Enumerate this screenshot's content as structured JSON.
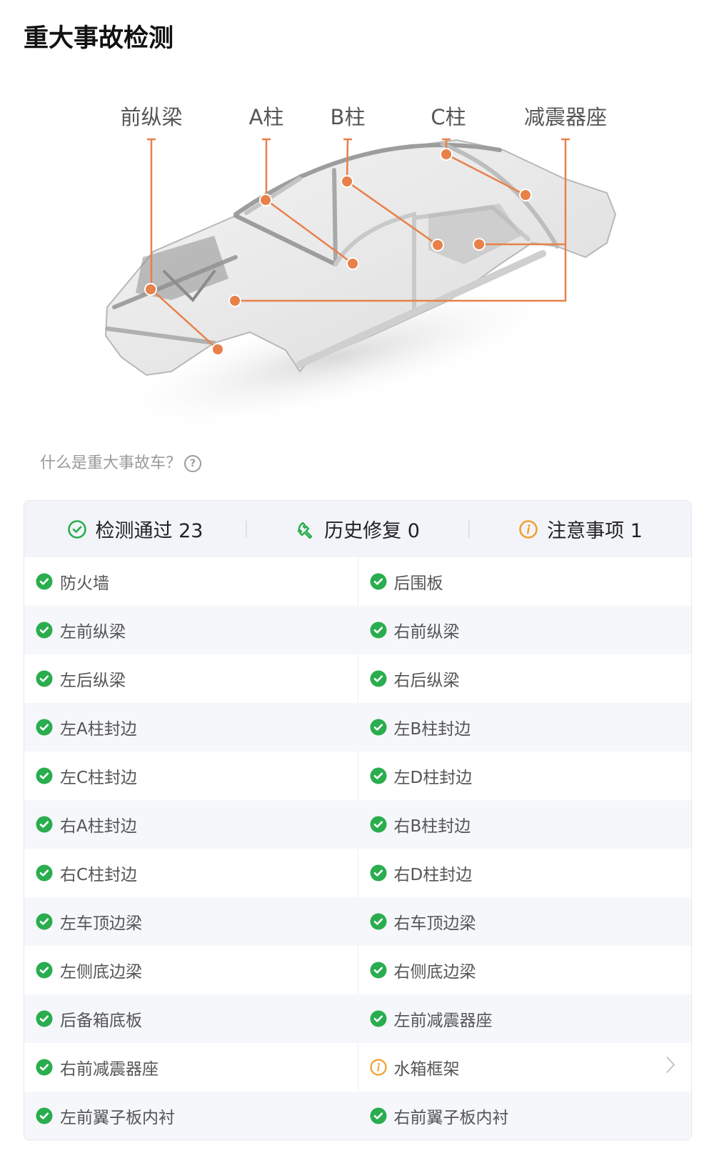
{
  "page": {
    "title": "重大事故检测",
    "help_text": "什么是重大事故车？",
    "help_icon": "question-circle-icon"
  },
  "diagram": {
    "accent_color": "#e8804a",
    "labels": [
      {
        "id": "front-rail",
        "text": "前纵梁"
      },
      {
        "id": "a-pillar",
        "text": "A柱"
      },
      {
        "id": "b-pillar",
        "text": "B柱"
      },
      {
        "id": "c-pillar",
        "text": "C柱"
      },
      {
        "id": "shock-tower",
        "text": "减震器座"
      }
    ]
  },
  "summary": {
    "passed": {
      "label": "检测通过",
      "count": "23",
      "icon": "check-circle-outline-icon",
      "color": "#2aad4e"
    },
    "repaired": {
      "label": "历史修复",
      "count": "0",
      "icon": "wrench-icon",
      "color": "#2aad4e"
    },
    "attention": {
      "label": "注意事项",
      "count": "1",
      "icon": "info-circle-icon",
      "color": "#f0a030"
    }
  },
  "colors": {
    "pass": "#2aad4e",
    "warn": "#f0a030"
  },
  "items": [
    [
      {
        "label": "防火墙",
        "status": "pass"
      },
      {
        "label": "后围板",
        "status": "pass"
      }
    ],
    [
      {
        "label": "左前纵梁",
        "status": "pass"
      },
      {
        "label": "右前纵梁",
        "status": "pass"
      }
    ],
    [
      {
        "label": "左后纵梁",
        "status": "pass"
      },
      {
        "label": "右后纵梁",
        "status": "pass"
      }
    ],
    [
      {
        "label": "左A柱封边",
        "status": "pass"
      },
      {
        "label": "左B柱封边",
        "status": "pass"
      }
    ],
    [
      {
        "label": "左C柱封边",
        "status": "pass"
      },
      {
        "label": "左D柱封边",
        "status": "pass"
      }
    ],
    [
      {
        "label": "右A柱封边",
        "status": "pass"
      },
      {
        "label": "右B柱封边",
        "status": "pass"
      }
    ],
    [
      {
        "label": "右C柱封边",
        "status": "pass"
      },
      {
        "label": "右D柱封边",
        "status": "pass"
      }
    ],
    [
      {
        "label": "左车顶边梁",
        "status": "pass"
      },
      {
        "label": "右车顶边梁",
        "status": "pass"
      }
    ],
    [
      {
        "label": "左侧底边梁",
        "status": "pass"
      },
      {
        "label": "右侧底边梁",
        "status": "pass"
      }
    ],
    [
      {
        "label": "后备箱底板",
        "status": "pass"
      },
      {
        "label": "左前减震器座",
        "status": "pass"
      }
    ],
    [
      {
        "label": "右前减震器座",
        "status": "pass"
      },
      {
        "label": "水箱框架",
        "status": "warn",
        "has_detail": true
      }
    ],
    [
      {
        "label": "左前翼子板内衬",
        "status": "pass"
      },
      {
        "label": "右前翼子板内衬",
        "status": "pass"
      }
    ]
  ]
}
